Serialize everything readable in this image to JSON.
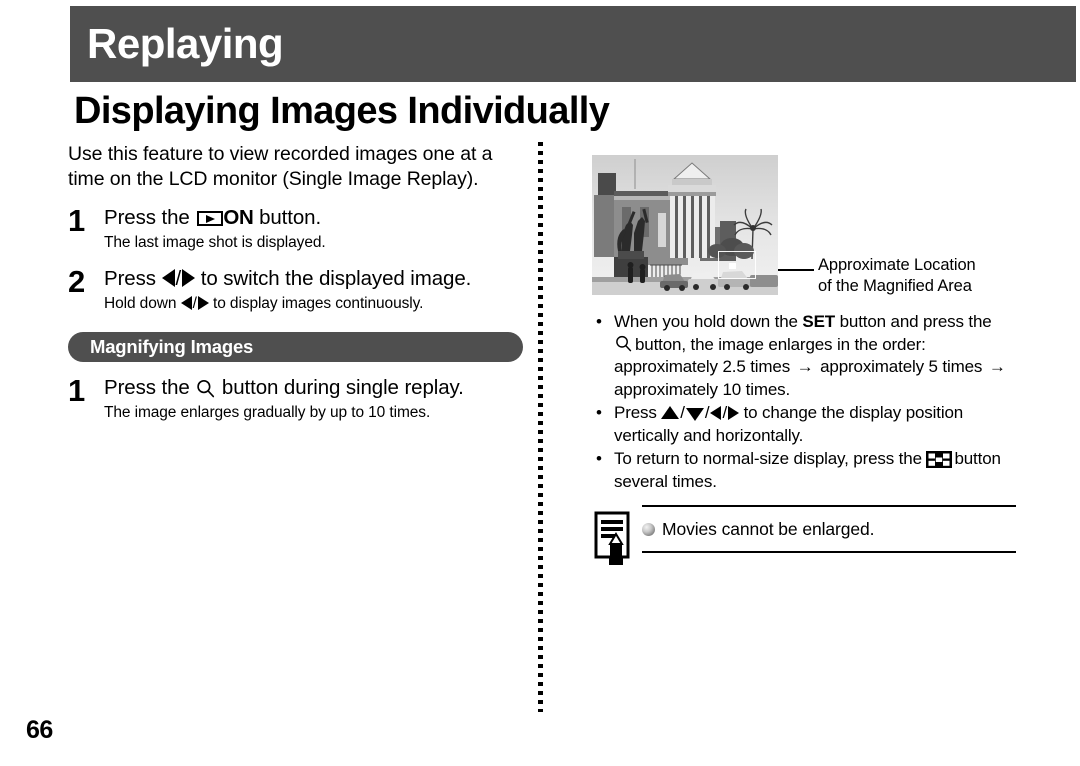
{
  "header": {
    "chapter_title": "Replaying",
    "chapter_band_color": "#4f4f4f"
  },
  "section": {
    "title": "Displaying Images Individually"
  },
  "left_column": {
    "intro": "Use this feature to view recorded images one at a time on the LCD monitor (Single Image Replay).",
    "steps": [
      {
        "number": "1",
        "head_before": "Press the",
        "icon": "playback-on-button-icon",
        "icon_label": "ON",
        "head_after": "button.",
        "sub": "The last image shot is displayed."
      },
      {
        "number": "2",
        "head_before": "Press",
        "icon_left": "left-arrow-icon",
        "icon_right": "right-arrow-icon",
        "head_after": "to switch the displayed image.",
        "sub_before": "Hold down",
        "sub_after": "to display images continuously."
      }
    ],
    "banner": {
      "label": "Magnifying Images",
      "color": "#4f4f4f"
    },
    "magnify_step": {
      "number": "1",
      "head_before": "Press the",
      "icon": "magnifier-icon",
      "head_after": "button during single replay.",
      "sub": "The image enlarges gradually by up to 10 times."
    }
  },
  "right_column": {
    "photo": {
      "alt": "black and white photograph of a neoclassical museum building with columns, an equestrian statue, palm trees and parked cars",
      "marker_name": "magnified-area-marker"
    },
    "callout": {
      "line1": "Approximate Location",
      "line2": "of the Magnified Area"
    },
    "bullets": [
      {
        "dot": "•",
        "part1": "When you hold down the",
        "bold1": "SET",
        "part2": "button and press the",
        "icon": "magnifier-icon",
        "part3": "button, the image enlarges in the order: approximately 2.5 times",
        "arrow1": "→",
        "part4": "approximately 5 times",
        "arrow2": "→",
        "part5": "approximately 10 times."
      },
      {
        "dot": "•",
        "part1": "Press",
        "icons": [
          "up-arrow-icon",
          "down-arrow-icon",
          "left-arrow-icon",
          "right-arrow-icon"
        ],
        "part2": "to change the display position vertically and horizontally."
      },
      {
        "dot": "•",
        "part1": "To return to normal-size display, press the",
        "icon": "thumbnail-grid-button-icon",
        "part2": "button several times."
      }
    ],
    "note": {
      "icon": "memo-pencil-icon",
      "bullet_icon": "gray-sphere-bullet",
      "text": "Movies cannot be enlarged."
    }
  },
  "footer": {
    "page_number": "66"
  }
}
